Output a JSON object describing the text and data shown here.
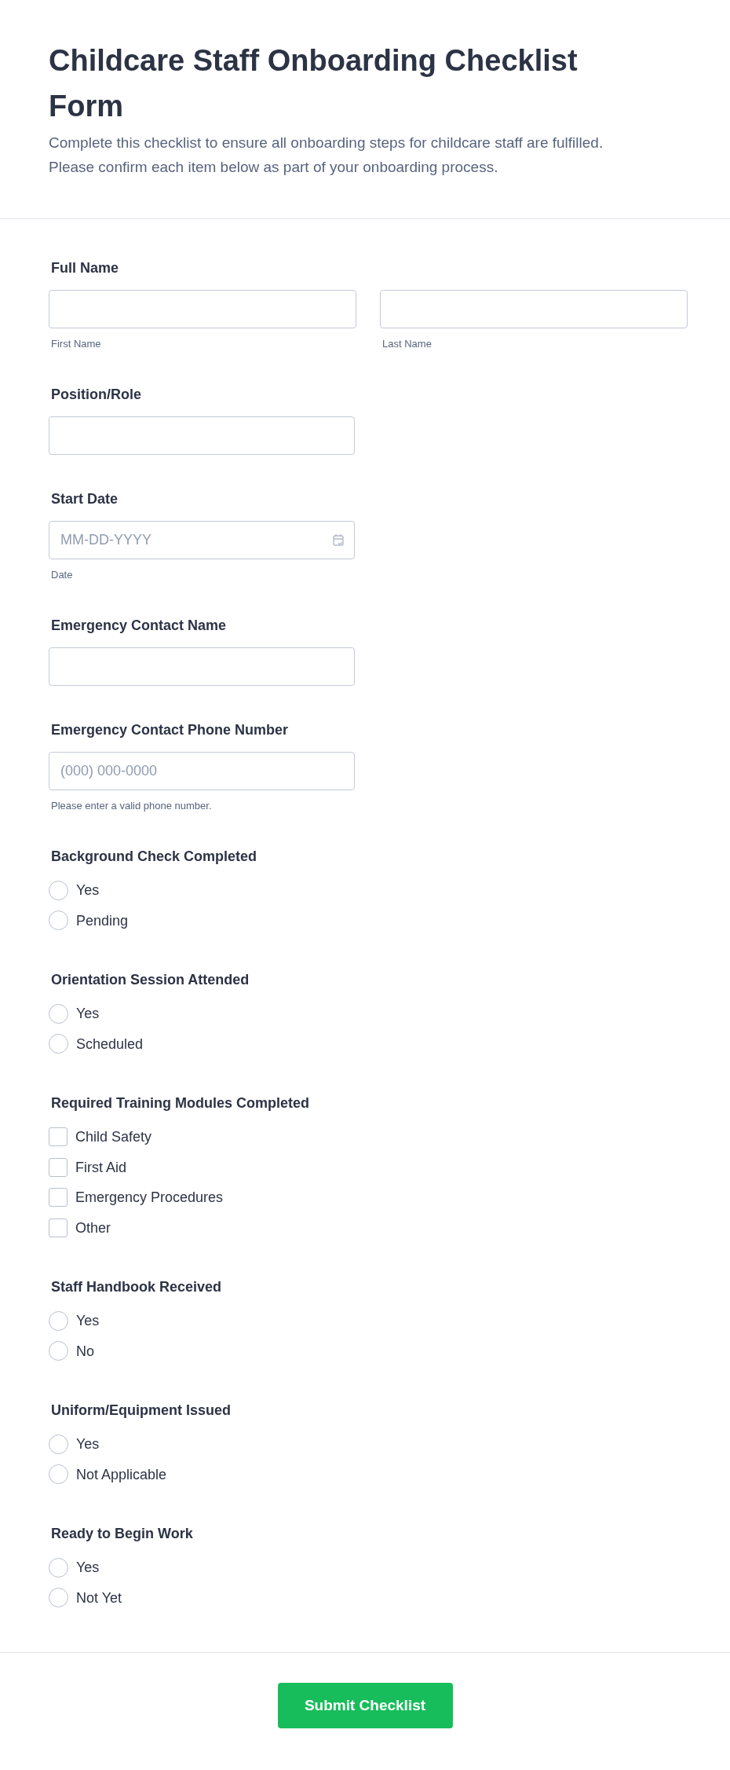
{
  "header": {
    "title": "Childcare Staff Onboarding Checklist Form",
    "description": "Complete this checklist to ensure all onboarding steps for childcare staff are fulfilled. Please confirm each item below as part of your onboarding process."
  },
  "fields": [
    {
      "kind": "name",
      "label": "Full Name",
      "sublabels": [
        "First Name",
        "Last Name"
      ]
    },
    {
      "kind": "text",
      "label": "Position/Role"
    },
    {
      "kind": "date",
      "label": "Start Date",
      "placeholder": "MM-DD-YYYY",
      "sublabel": "Date"
    },
    {
      "kind": "text",
      "label": "Emergency Contact Name"
    },
    {
      "kind": "phone",
      "label": "Emergency Contact Phone Number",
      "placeholder": "(000) 000-0000",
      "sublabel": "Please enter a valid phone number."
    },
    {
      "kind": "radio",
      "label": "Background Check Completed",
      "options": [
        {
          "label": "Yes",
          "selected": false
        },
        {
          "label": "Pending",
          "selected": false
        }
      ]
    },
    {
      "kind": "radio",
      "label": "Orientation Session Attended",
      "options": [
        {
          "label": "Yes",
          "selected": false
        },
        {
          "label": "Scheduled",
          "selected": false
        }
      ]
    },
    {
      "kind": "checkbox",
      "label": "Required Training Modules Completed",
      "options": [
        {
          "label": "Child Safety",
          "checked": false
        },
        {
          "label": "First Aid",
          "checked": false
        },
        {
          "label": "Emergency Procedures",
          "checked": false
        },
        {
          "label": "Other",
          "checked": false
        }
      ]
    },
    {
      "kind": "radio",
      "label": "Staff Handbook Received",
      "options": [
        {
          "label": "Yes",
          "selected": false
        },
        {
          "label": "No",
          "selected": false
        }
      ]
    },
    {
      "kind": "radio",
      "label": "Uniform/Equipment Issued",
      "options": [
        {
          "label": "Yes",
          "selected": false
        },
        {
          "label": "Not Applicable",
          "selected": false
        }
      ]
    },
    {
      "kind": "radio",
      "label": "Ready to Begin Work",
      "options": [
        {
          "label": "Yes",
          "selected": false
        },
        {
          "label": "Not Yet",
          "selected": false
        }
      ]
    }
  ],
  "submit": "Submit Checklist"
}
